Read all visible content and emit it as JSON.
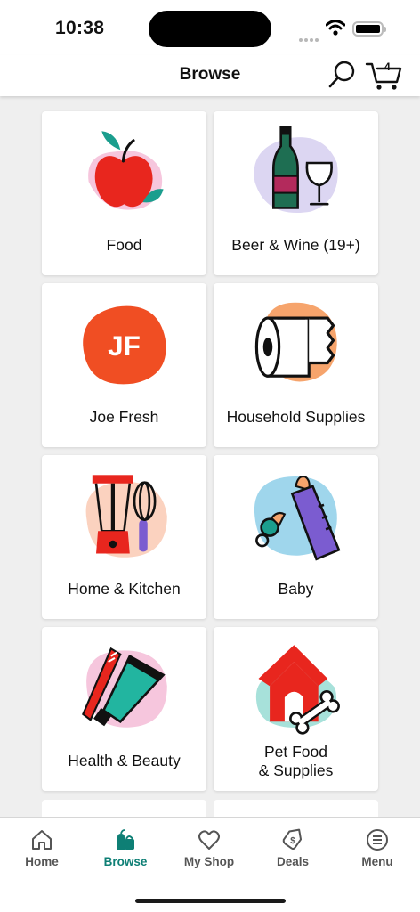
{
  "status_bar": {
    "time": "10:38"
  },
  "header": {
    "title": "Browse",
    "cart_count": "4"
  },
  "categories": [
    {
      "label": "Food",
      "icon": "apple-icon"
    },
    {
      "label": "Beer & Wine (19+)",
      "icon": "wine-bottle-icon"
    },
    {
      "label": "Joe Fresh",
      "icon": "joe-fresh-logo-icon",
      "logo_text": "JF"
    },
    {
      "label": "Household Supplies",
      "icon": "paper-towel-icon"
    },
    {
      "label": "Home & Kitchen",
      "icon": "blender-whisk-icon"
    },
    {
      "label": "Baby",
      "icon": "baby-bottle-icon"
    },
    {
      "label": "Health & Beauty",
      "icon": "toothbrush-toothpaste-icon"
    },
    {
      "label_line1": "Pet Food",
      "label_line2": "& Supplies",
      "icon": "doghouse-bone-icon"
    }
  ],
  "tabbar": {
    "items": [
      {
        "label": "Home",
        "icon": "home-icon"
      },
      {
        "label": "Browse",
        "icon": "browse-groceries-icon",
        "active": true
      },
      {
        "label": "My Shop",
        "icon": "heart-icon"
      },
      {
        "label": "Deals",
        "icon": "tag-icon"
      },
      {
        "label": "Menu",
        "icon": "menu-icon"
      }
    ]
  },
  "colors": {
    "accent": "#0e7f75",
    "background": "#efefef",
    "tile": "#ffffff"
  }
}
